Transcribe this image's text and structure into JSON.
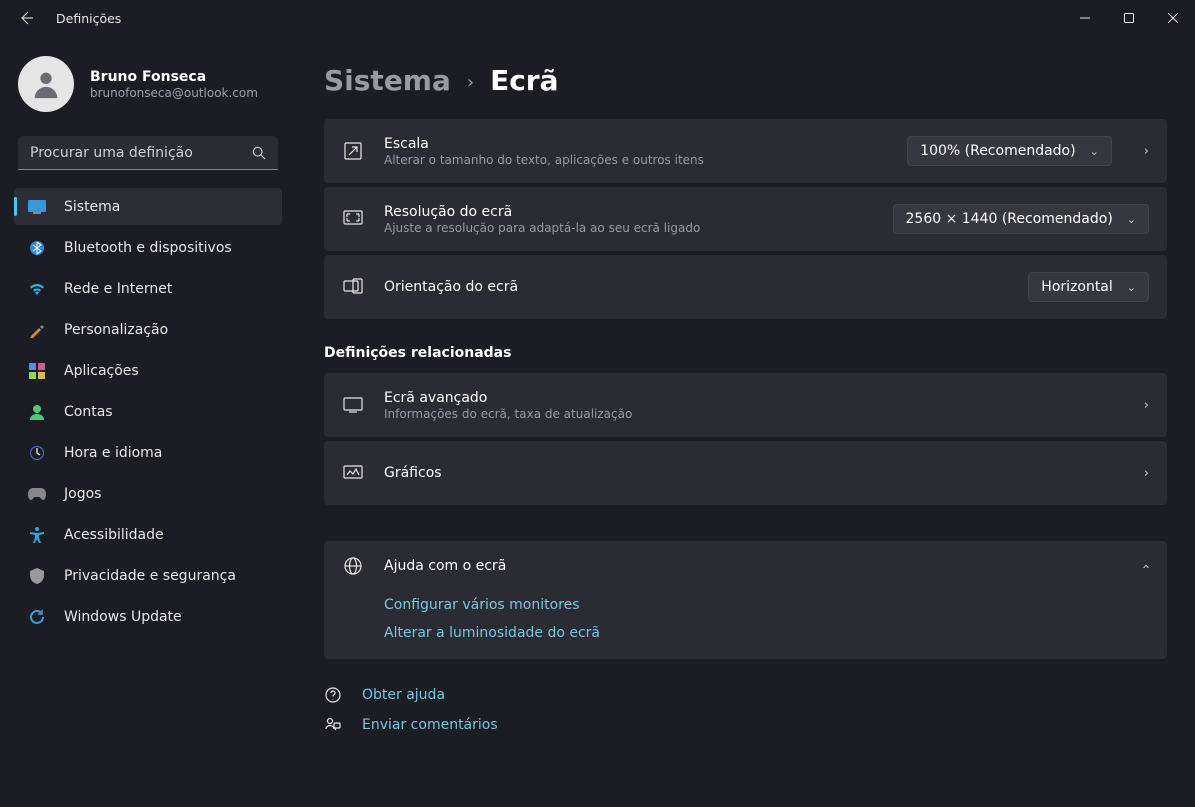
{
  "window": {
    "title": "Definições"
  },
  "profile": {
    "name": "Bruno Fonseca",
    "email": "brunofonseca@outlook.com"
  },
  "search": {
    "placeholder": "Procurar uma definição"
  },
  "nav": {
    "items": [
      {
        "label": "Sistema",
        "active": true
      },
      {
        "label": "Bluetooth e dispositivos"
      },
      {
        "label": "Rede e Internet"
      },
      {
        "label": "Personalização"
      },
      {
        "label": "Aplicações"
      },
      {
        "label": "Contas"
      },
      {
        "label": "Hora e idioma"
      },
      {
        "label": "Jogos"
      },
      {
        "label": "Acessibilidade"
      },
      {
        "label": "Privacidade e segurança"
      },
      {
        "label": "Windows Update"
      }
    ]
  },
  "breadcrumb": {
    "parent": "Sistema",
    "current": "Ecrã"
  },
  "settings": {
    "scale": {
      "title": "Escala",
      "desc": "Alterar o tamanho do texto, aplicações e outros itens",
      "value": "100% (Recomendado)"
    },
    "resolution": {
      "title": "Resolução do ecrã",
      "desc": "Ajuste a resolução para adaptá-la ao seu ecrã ligado",
      "value": "2560 × 1440 (Recomendado)"
    },
    "orientation": {
      "title": "Orientação do ecrã",
      "value": "Horizontal"
    }
  },
  "related": {
    "header": "Definições relacionadas",
    "advanced": {
      "title": "Ecrã avançado",
      "desc": "Informações do ecrã, taxa de atualização"
    },
    "graphics": {
      "title": "Gráficos"
    }
  },
  "help": {
    "title": "Ajuda com o ecrã",
    "links": [
      "Configurar vários monitores",
      "Alterar a luminosidade do ecrã"
    ]
  },
  "footer": {
    "get_help": "Obter ajuda",
    "feedback": "Enviar comentários"
  }
}
